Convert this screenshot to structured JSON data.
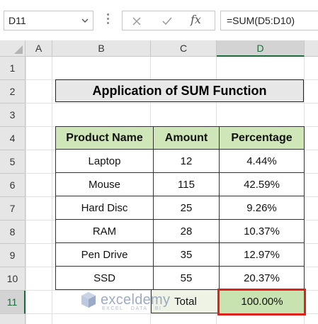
{
  "formula_bar": {
    "name_box": "D11",
    "formula": "=SUM(D5:D10)",
    "cancel_icon": "close-icon",
    "enter_icon": "check-icon",
    "function_icon": "fx-icon",
    "fx_label": "fx"
  },
  "columns": [
    "A",
    "B",
    "C",
    "D"
  ],
  "rows": [
    "1",
    "2",
    "3",
    "4",
    "5",
    "6",
    "7",
    "8",
    "9",
    "10",
    "11"
  ],
  "selected_cell": "D11",
  "sheet": {
    "title": "Application of SUM Function",
    "headers": [
      "Product Name",
      "Amount",
      "Percentage"
    ],
    "data": [
      [
        "Laptop",
        "12",
        "4.44%"
      ],
      [
        "Mouse",
        "115",
        "42.59%"
      ],
      [
        "Hard Disc",
        "25",
        "9.26%"
      ],
      [
        "RAM",
        "28",
        "10.37%"
      ],
      [
        "Pen Drive",
        "35",
        "12.97%"
      ],
      [
        "SSD",
        "55",
        "20.37%"
      ]
    ],
    "total_label": "Total",
    "total_value": "100.00%"
  },
  "watermark": {
    "brand": "exceldemy",
    "tagline": "EXCEL · DATA · BI",
    "icon": "exceldemy-logo-icon"
  },
  "colors": {
    "header_fill": "#cfe6b8",
    "title_fill": "#e7e7e7",
    "total_fill": "#c9e3b0",
    "selection_border": "#e0201b",
    "excel_green": "#1d6b3c"
  }
}
